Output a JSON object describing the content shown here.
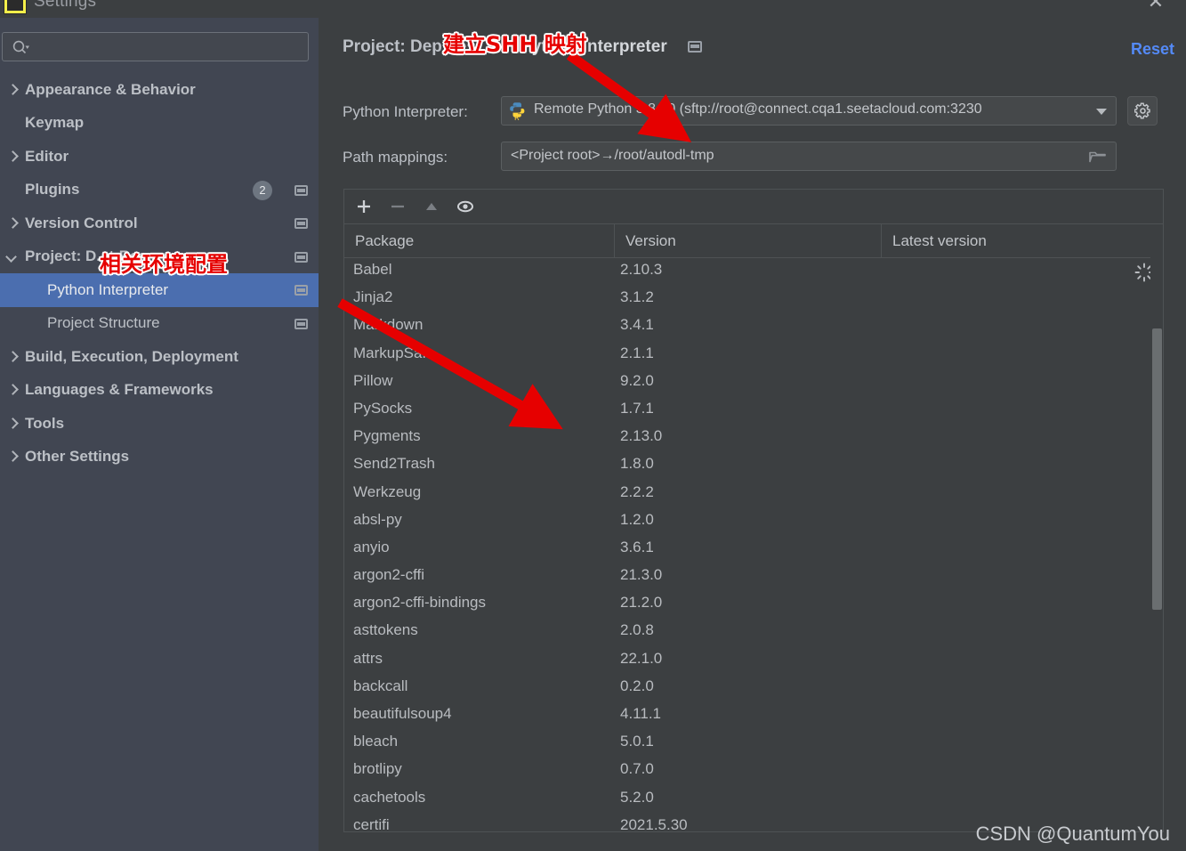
{
  "window": {
    "title": "Settings",
    "close_label": "✕",
    "app_icon": "pycharm-icon"
  },
  "sidebar": {
    "search": {
      "value": "",
      "placeholder": ""
    },
    "items": [
      {
        "label": "Appearance & Behavior",
        "arrow": "closed",
        "bold": true,
        "indent": false,
        "badge": null,
        "mini": false,
        "selected": false
      },
      {
        "label": "Keymap",
        "arrow": "none",
        "bold": true,
        "indent": false,
        "badge": null,
        "mini": false,
        "selected": false
      },
      {
        "label": "Editor",
        "arrow": "closed",
        "bold": true,
        "indent": false,
        "badge": null,
        "mini": false,
        "selected": false
      },
      {
        "label": "Plugins",
        "arrow": "none",
        "bold": true,
        "indent": false,
        "badge": "2",
        "mini": true,
        "selected": false
      },
      {
        "label": "Version Control",
        "arrow": "closed",
        "bold": true,
        "indent": false,
        "badge": null,
        "mini": true,
        "selected": false
      },
      {
        "label": "Project: D...t-Res...",
        "arrow": "open",
        "bold": true,
        "indent": false,
        "badge": null,
        "mini": true,
        "selected": false
      },
      {
        "label": "Python Interpreter",
        "arrow": "none",
        "bold": false,
        "indent": true,
        "badge": null,
        "mini": true,
        "selected": true
      },
      {
        "label": "Project Structure",
        "arrow": "none",
        "bold": false,
        "indent": true,
        "badge": null,
        "mini": true,
        "selected": false
      },
      {
        "label": "Build, Execution, Deployment",
        "arrow": "closed",
        "bold": true,
        "indent": false,
        "badge": null,
        "mini": false,
        "selected": false
      },
      {
        "label": "Languages & Frameworks",
        "arrow": "closed",
        "bold": true,
        "indent": false,
        "badge": null,
        "mini": false,
        "selected": false
      },
      {
        "label": "Tools",
        "arrow": "closed",
        "bold": true,
        "indent": false,
        "badge": null,
        "mini": false,
        "selected": false
      },
      {
        "label": "Other Settings",
        "arrow": "closed",
        "bold": true,
        "indent": false,
        "badge": null,
        "mini": false,
        "selected": false
      }
    ]
  },
  "main": {
    "breadcrumb": {
      "first": "Project: Dep            t    es...",
      "separator": "›",
      "last": "Python Interpreter"
    },
    "reset_label": "Reset",
    "interpreter": {
      "label": "Python Interpreter:",
      "value": "Remote Python 3.8.10 (sftp://root@connect.cqa1.seetacloud.com:3230",
      "icon": "python-remote-icon"
    },
    "path_mappings": {
      "label": "Path mappings:",
      "value": "<Project root>→/root/autodl-tmp",
      "browse_icon": "folder-icon"
    },
    "toolbar": {
      "add_label": "+",
      "remove_label": "−",
      "upgrade_label": "▲",
      "show_early_label": "eye"
    },
    "table": {
      "columns": [
        "Package",
        "Version",
        "Latest version"
      ],
      "rows": [
        {
          "package": "Babel",
          "version": "2.10.3",
          "latest": ""
        },
        {
          "package": "Jinja2",
          "version": "3.1.2",
          "latest": ""
        },
        {
          "package": "Markdown",
          "version": "3.4.1",
          "latest": ""
        },
        {
          "package": "MarkupSafe",
          "version": "2.1.1",
          "latest": ""
        },
        {
          "package": "Pillow",
          "version": "9.2.0",
          "latest": ""
        },
        {
          "package": "PySocks",
          "version": "1.7.1",
          "latest": ""
        },
        {
          "package": "Pygments",
          "version": "2.13.0",
          "latest": ""
        },
        {
          "package": "Send2Trash",
          "version": "1.8.0",
          "latest": ""
        },
        {
          "package": "Werkzeug",
          "version": "2.2.2",
          "latest": ""
        },
        {
          "package": "absl-py",
          "version": "1.2.0",
          "latest": ""
        },
        {
          "package": "anyio",
          "version": "3.6.1",
          "latest": ""
        },
        {
          "package": "argon2-cffi",
          "version": "21.3.0",
          "latest": ""
        },
        {
          "package": "argon2-cffi-bindings",
          "version": "21.2.0",
          "latest": ""
        },
        {
          "package": "asttokens",
          "version": "2.0.8",
          "latest": ""
        },
        {
          "package": "attrs",
          "version": "22.1.0",
          "latest": ""
        },
        {
          "package": "backcall",
          "version": "0.2.0",
          "latest": ""
        },
        {
          "package": "beautifulsoup4",
          "version": "4.11.1",
          "latest": ""
        },
        {
          "package": "bleach",
          "version": "5.0.1",
          "latest": ""
        },
        {
          "package": "brotlipy",
          "version": "0.7.0",
          "latest": ""
        },
        {
          "package": "cachetools",
          "version": "5.2.0",
          "latest": ""
        },
        {
          "package": "certifi",
          "version": "2021.5.30",
          "latest": ""
        }
      ]
    }
  },
  "annotations": {
    "breadcrumb_note": "建立SHH 映射",
    "sidebar_note": "相关环境配置",
    "color": "#e60000"
  },
  "watermark": "CSDN @QuantumYou",
  "colors": {
    "sidebar_bg": "#414652",
    "main_bg": "#3c3f41",
    "selection": "#4b6eaf",
    "accent_link": "#548af7",
    "text": "#bcc0c6"
  }
}
